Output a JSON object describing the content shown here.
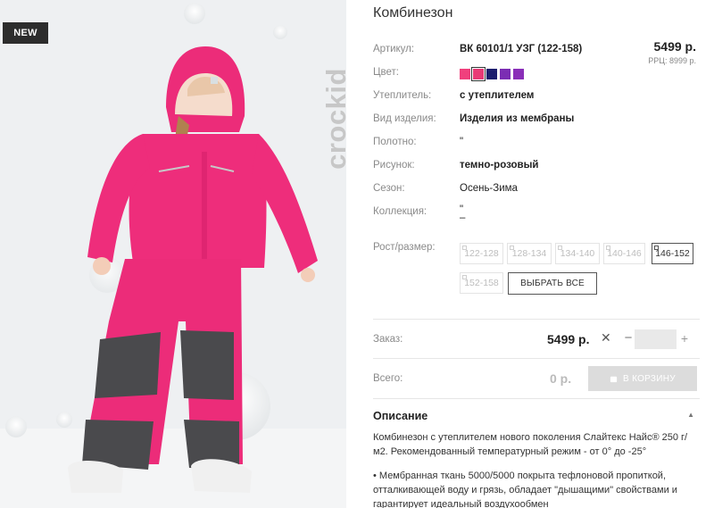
{
  "photo": {
    "badge": "NEW",
    "brand": "crockid"
  },
  "product": {
    "title": "Комбинезон",
    "price": "5499 р.",
    "rrc": "РРЦ: 8999 р.",
    "attributes": [
      {
        "label": "Артикул:",
        "value": "ВК 60101/1 УЗГ (122-158)",
        "bold": true
      },
      {
        "label": "Цвет:",
        "value": "",
        "bold": false
      },
      {
        "label": "Утеплитель:",
        "value": "с утеплителем",
        "bold": true
      },
      {
        "label": "Вид изделия:",
        "value": "Изделия из мембраны",
        "bold": true
      },
      {
        "label": "Полотно:",
        "value": "\"",
        "bold": false
      },
      {
        "label": "Рисунок:",
        "value": "темно-розовый",
        "bold": true
      },
      {
        "label": "Сезон:",
        "value": "Осень-Зима",
        "bold": false
      },
      {
        "label": "Коллекция:",
        "value": "\"",
        "bold": false
      }
    ],
    "collection_extra": "–",
    "colors": [
      "#f0407d",
      "#e83a76",
      "#1c1d6e",
      "#7b2db3",
      "#8a2fb8"
    ]
  },
  "sizes": {
    "label": "Рост/размер:",
    "options": [
      "122-128",
      "128-134",
      "134-140",
      "140-146",
      "146-152",
      "152-158"
    ],
    "active": "146-152",
    "select_all": "ВЫБРАТЬ ВСЕ"
  },
  "order": {
    "label": "Заказ:",
    "price": "5499 р.",
    "times": "✕",
    "minus": "−",
    "plus": "+",
    "qty": ""
  },
  "total": {
    "label": "Всего:",
    "value": "0 р.",
    "cart_button": "В КОРЗИНУ"
  },
  "description": {
    "title": "Описание",
    "caret": "▲",
    "paragraph1_line1": "Комбинезон с утеплителем нового поколения Слайтекс Найс® 250 г/",
    "paragraph1_line2": "м2. Рекомендованный температурный режим - от 0° до -25°",
    "paragraph2_line1": "• Мембранная ткань 5000/5000 покрыта тефлоновой пропиткой,",
    "paragraph2_line2": "отталкивающей воду и грязь, обладает \"дышащими\" свойствами и",
    "paragraph2_line3": "гарантирует идеальный воздухообмен"
  }
}
